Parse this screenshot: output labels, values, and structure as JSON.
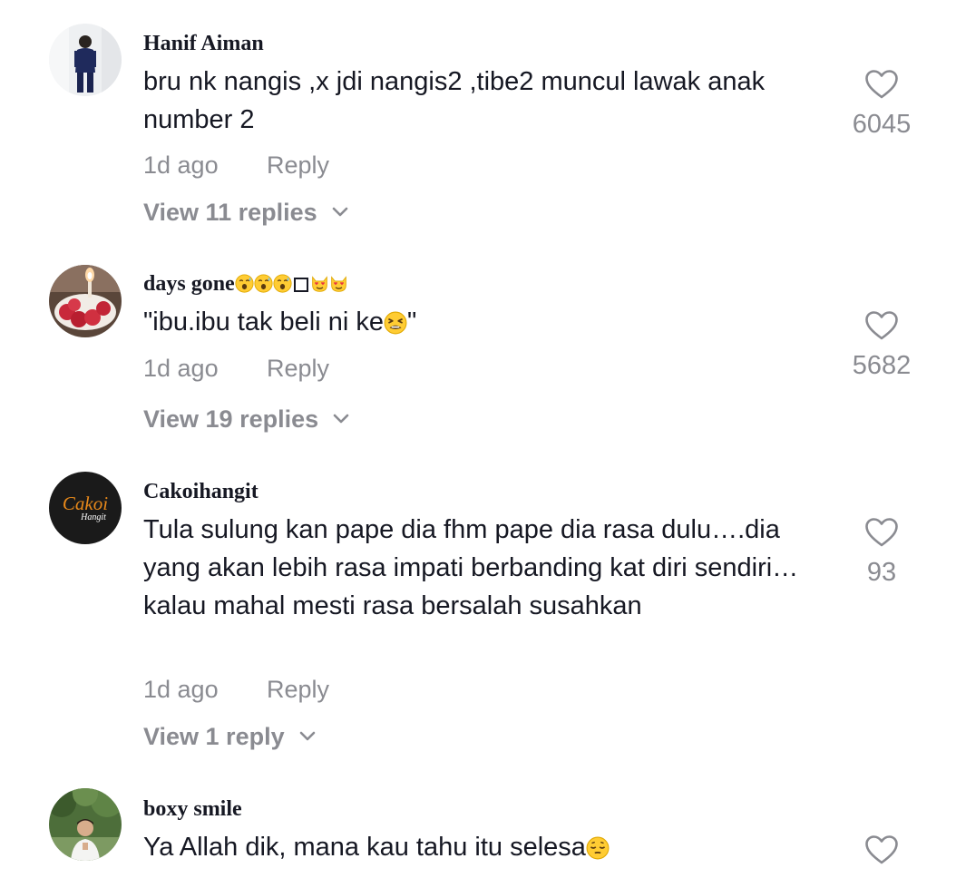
{
  "comments": [
    {
      "username": "Hanif Aiman",
      "text": "bru nk nangis ,x jdi nangis2 ,tibe2 muncul lawak anak number 2",
      "time": "1d ago",
      "reply_label": "Reply",
      "view_replies": "View 11 replies",
      "likes": "6045",
      "avatar": "person-standing-photo"
    },
    {
      "username": "days gone",
      "username_emojis": [
        "face-with-open-mouth-sweat",
        "face-with-open-mouth-sweat",
        "face-with-open-mouth-sweat",
        "missing-glyph-box",
        "heart-eyes-cat",
        "heart-eyes-cat"
      ],
      "text": "\"ibu.ibu tak beli ni ke",
      "text_end": "\"",
      "text_emoji": "tired-face",
      "time": "1d ago",
      "reply_label": "Reply",
      "view_replies": "View 19 replies",
      "likes": "5682",
      "avatar": "strawberry-cake-photo"
    },
    {
      "username": "Cakoihangit",
      "text": "Tula sulung kan pape dia fhm pape dia rasa dulu….dia yang akan lebih rasa impati berbanding kat diri sendiri…kalau mahal mesti rasa bersalah susahkan",
      "time": "1d ago",
      "reply_label": "Reply",
      "view_replies": "View 1 reply",
      "likes": "93",
      "avatar": "cakoi-logo",
      "avatar_logo": "Cakoi",
      "avatar_logo_sub": "Hangit"
    },
    {
      "username": "boxy smile",
      "text": "Ya Allah dik, mana kau tahu itu selesa",
      "text_emoji": "pensive-face",
      "avatar": "person-outdoor-photo"
    }
  ],
  "colors": {
    "primary_text": "#161823",
    "secondary_text": "#8a8b91",
    "background": "#ffffff"
  }
}
